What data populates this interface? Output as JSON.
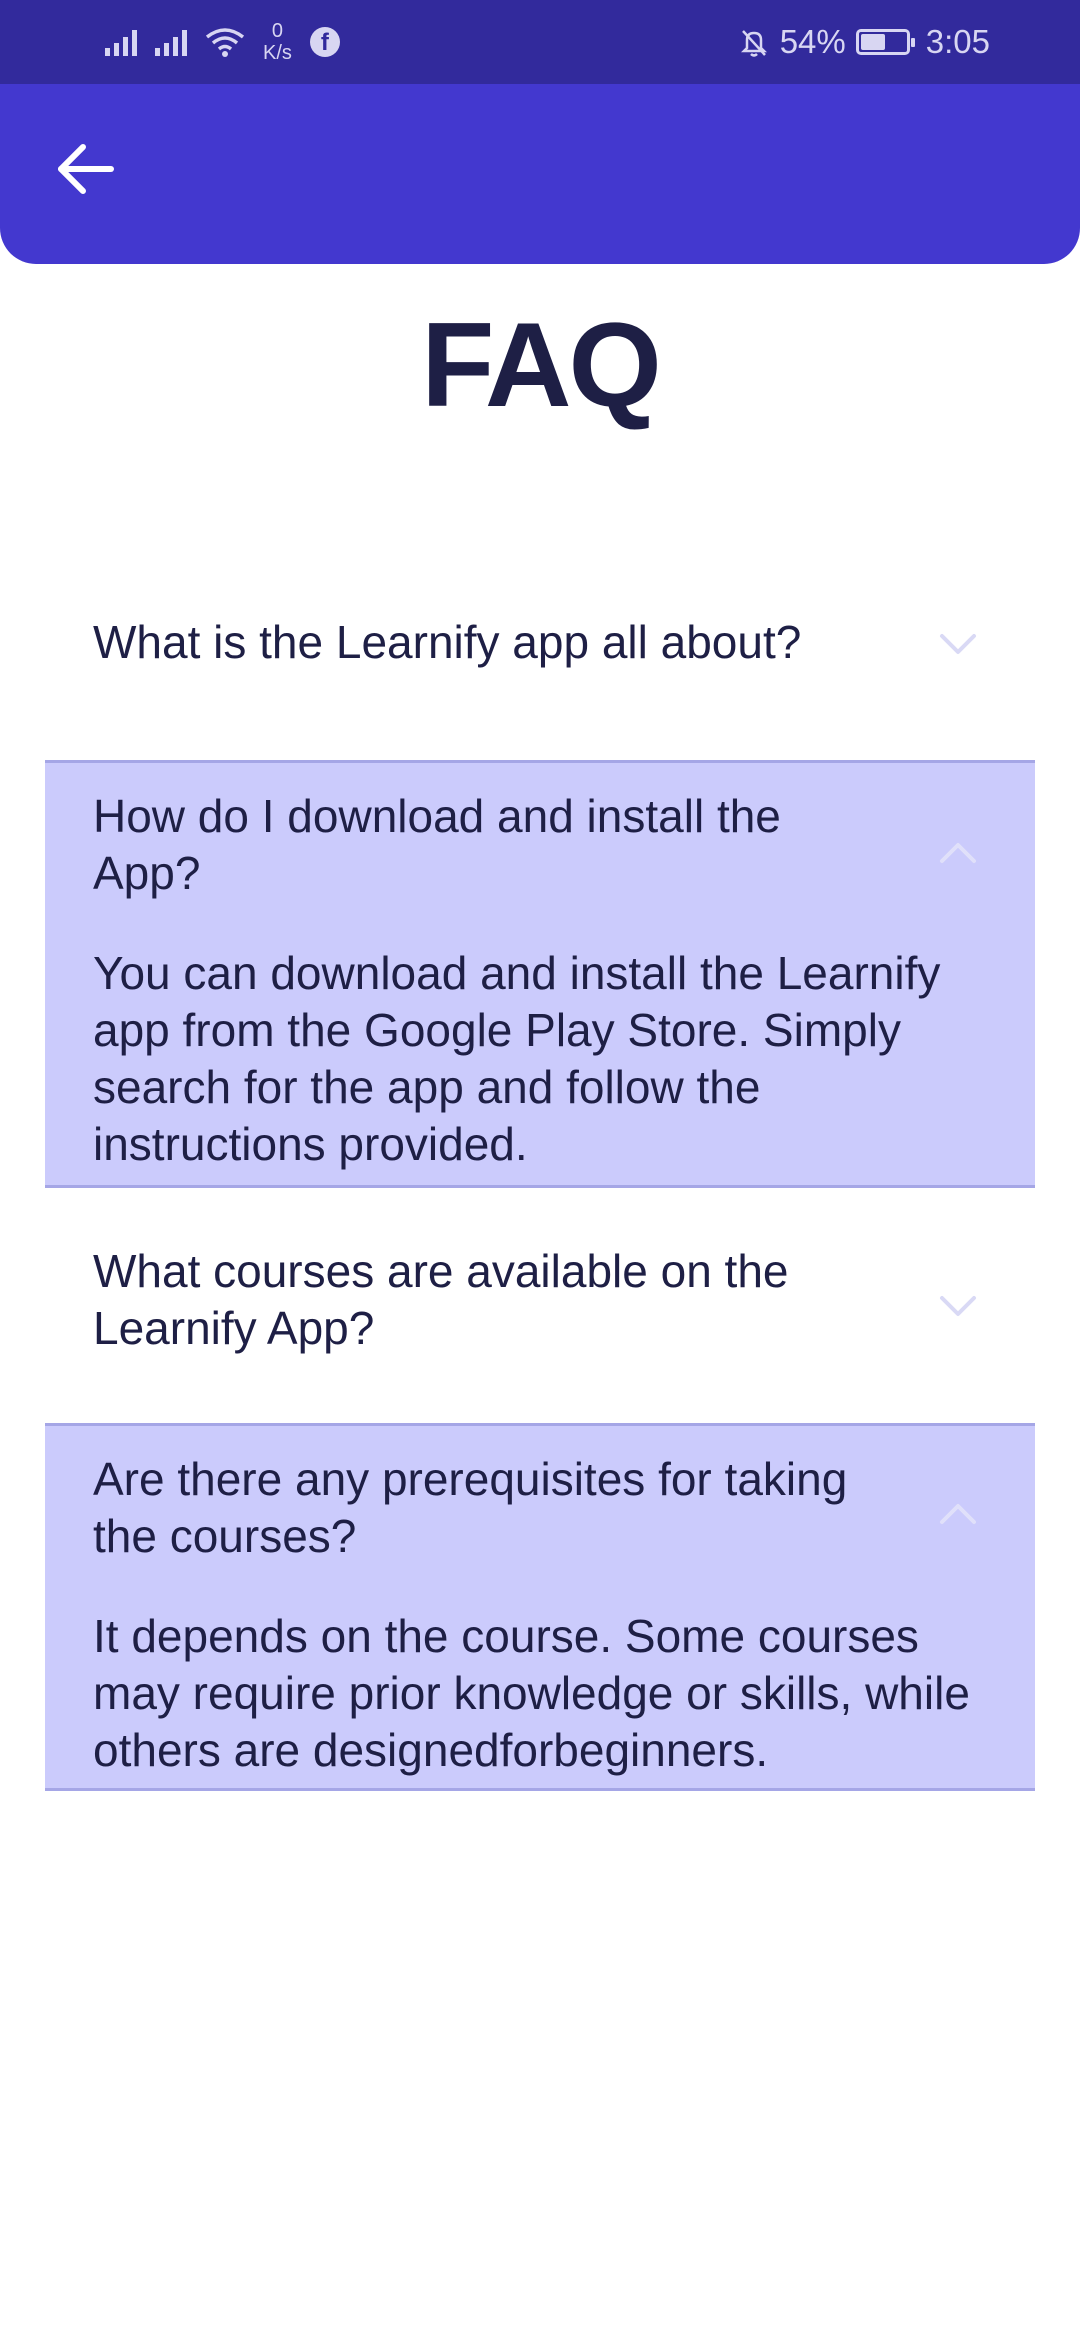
{
  "status_bar": {
    "net_speed_value": "0",
    "net_speed_unit": "K/s",
    "battery_percent": "54%",
    "battery_level": 0.54,
    "time": "3:05"
  },
  "app_bar": {
    "back_icon": "arrow-left-icon",
    "color": "#4338CF"
  },
  "page": {
    "title": "FAQ"
  },
  "faq": {
    "items": [
      {
        "question": "What is the Learnify app all about?",
        "expanded": false,
        "answer": ""
      },
      {
        "question": "How do I download and install the App?",
        "expanded": true,
        "answer": "You can download and install the Learnify app from the Google Play Store. Simply search for the app and follow the instructions provided."
      },
      {
        "question": "What courses are available on the Learnify App?",
        "expanded": false,
        "answer": ""
      },
      {
        "question": "Are there any prerequisites for taking the courses?",
        "expanded": true,
        "answer": "It depends on the course. Some courses may require prior knowledge or skills, while others are designedforbeginners."
      }
    ]
  },
  "colors": {
    "status_bar": "#322A9C",
    "expanded_bg": "#CBCBFC",
    "text": "#1E1F45",
    "chevron": "#D9D9F5"
  }
}
